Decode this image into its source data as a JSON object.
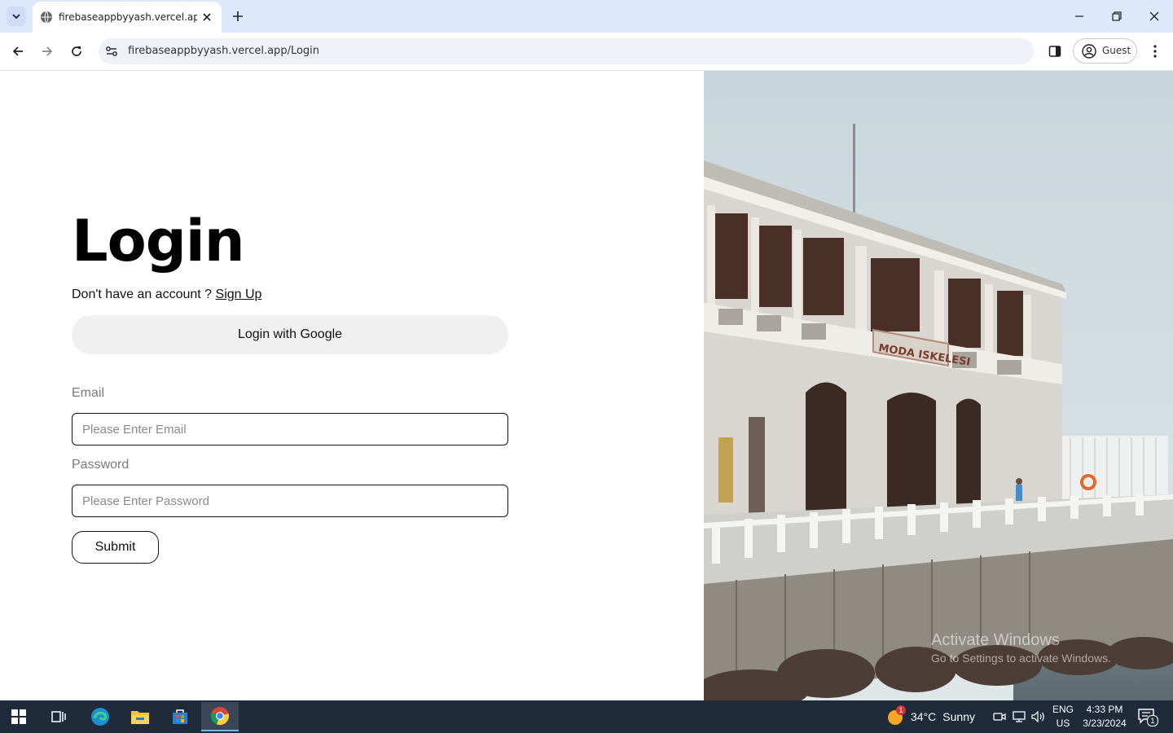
{
  "browser": {
    "tab_title": "firebaseappbyyash.vercel.app/Lo",
    "url": "firebaseappbyyash.vercel.app/Login",
    "profile_label": "Guest"
  },
  "page": {
    "heading": "Login",
    "signup_prompt": "Don't have an account ?",
    "signup_link": "Sign Up",
    "google_button": "Login with Google",
    "email_label": "Email",
    "email_placeholder": "Please Enter Email",
    "password_label": "Password",
    "password_placeholder": "Please Enter Password",
    "submit_button": "Submit"
  },
  "watermark": {
    "title": "Activate Windows",
    "subtitle": "Go to Settings to activate Windows."
  },
  "photo": {
    "building_sign": "MODA ISKELESI"
  },
  "taskbar": {
    "weather_temp": "34°C",
    "weather_desc": "Sunny",
    "weather_badge": "1",
    "lang_line1": "ENG",
    "lang_line2": "US",
    "time": "4:33 PM",
    "date": "3/23/2024",
    "notification_count": "1"
  }
}
